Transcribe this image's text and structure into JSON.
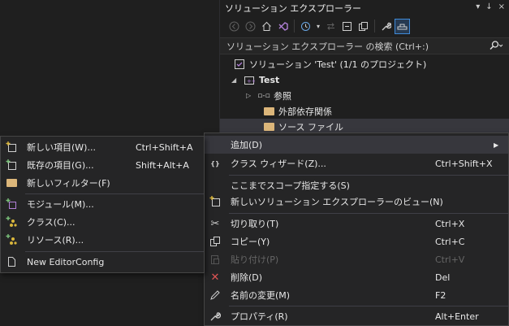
{
  "colors": {
    "accent": "#3f8ad9",
    "menu_bg": "#252526",
    "highlight": "#37373d",
    "folder": "#dcb67a",
    "delete": "#e05555"
  },
  "solution_explorer": {
    "title": "ソリューション エクスプローラー",
    "title_controls": [
      "▾",
      "↓",
      "×"
    ],
    "toolbar": [
      "back-icon",
      "forward-icon",
      "home-icon",
      "vs-icon",
      "history-icon",
      "sync-icon",
      "collapse-icon",
      "show-all-icon",
      "wrench-icon",
      "preview-icon"
    ],
    "search_placeholder": "ソリューション エクスプローラー の検索 (Ctrl+:)",
    "tree": {
      "solution": "ソリューション 'Test' (1/1 のプロジェクト)",
      "project": "Test",
      "references": "参照",
      "external_deps": "外部依存関係",
      "source_files": "ソース ファイル"
    }
  },
  "context_menu": {
    "items": [
      {
        "label": "追加(D)",
        "shortcut": "",
        "icon": "",
        "submenu": true
      },
      {
        "label": "クラス ウィザード(Z)...",
        "shortcut": "Ctrl+Shift+X",
        "icon": "class-wizard-icon"
      },
      {
        "label": "ここまでスコープ指定する(S)",
        "shortcut": "",
        "icon": ""
      },
      {
        "label": "新しいソリューション エクスプローラーのビュー(N)",
        "shortcut": "",
        "icon": "new-view-icon"
      },
      {
        "label": "切り取り(T)",
        "shortcut": "Ctrl+X",
        "icon": "scissors-icon"
      },
      {
        "label": "コピー(Y)",
        "shortcut": "Ctrl+C",
        "icon": "copy-icon"
      },
      {
        "label": "貼り付け(P)",
        "shortcut": "Ctrl+V",
        "icon": "paste-icon",
        "disabled": true
      },
      {
        "label": "削除(D)",
        "shortcut": "Del",
        "icon": "delete-icon"
      },
      {
        "label": "名前の変更(M)",
        "shortcut": "F2",
        "icon": "rename-icon"
      },
      {
        "label": "プロパティ(R)",
        "shortcut": "Alt+Enter",
        "icon": "wrench-icon"
      }
    ]
  },
  "submenu": {
    "items": [
      {
        "label": "新しい項目(W)...",
        "shortcut": "Ctrl+Shift+A"
      },
      {
        "label": "既存の項目(G)...",
        "shortcut": "Shift+Alt+A"
      },
      {
        "label": "新しいフィルター(F)",
        "shortcut": ""
      },
      {
        "label": "モジュール(M)...",
        "shortcut": ""
      },
      {
        "label": "クラス(C)...",
        "shortcut": ""
      },
      {
        "label": "リソース(R)...",
        "shortcut": ""
      },
      {
        "label": "New EditorConfig",
        "shortcut": ""
      }
    ]
  }
}
